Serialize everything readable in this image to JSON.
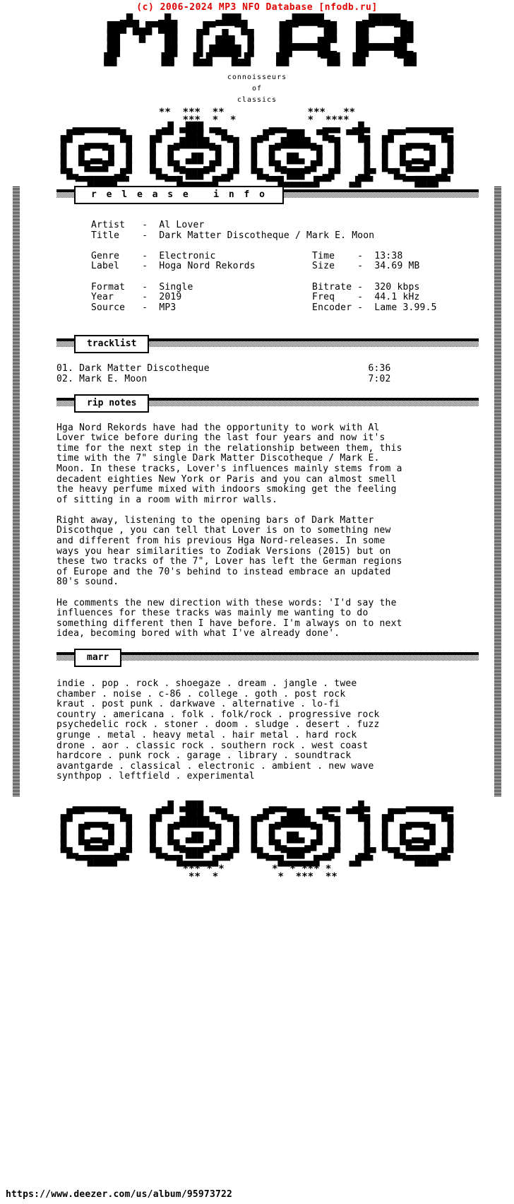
{
  "header": {
    "copyright": "(c) 2006-2024 MP3 NFO Database [nfodb.ru]",
    "copyright_color": "#e00000"
  },
  "logo": {
    "name": "MARR",
    "ascii": "  ▄█▄   ▄█▄      ▄███▄      ▄█████▄     ▄█████▄\n ███▀█▄█▀███    █▀   ▀█     ██▀   ▀██   ██▀   ▀██\n ██  ▀█▀  ██   █▀ ▄█▄ ▀█    ██     ██   ██     ██\n ██   ▀   ██   █  ███  █    ██▄▄▄▄██▀   ██▄▄▄▄██▀\n ██       ██   █ █████ █    ██▀▀▀▀██▄   ██▀▀▀▀██▄\n ██       ██   █▄█   █▄█    ██     ▀██  ██     ▀██\n ▀▀       ▀▀   ▀▀▀   ▀▀▀    ▀▀      ▀▀  ▀▀      ▀▀",
    "tagline_1": "connoisseurs",
    "tagline_2": "of",
    "tagline_3": "classics",
    "ornament_top": "  ▄▄▄▄▄▄▄▄       ▄█ ▄███ ▄▄        ▄▄▄      ▄▄▄  ▄█▄      ▄▄▄▄▄▄▄▄\n▄█▀▀    ▀▀█▄   ▄█▀▀  ███  ▀█▄    ▄█▀  ███  ▀█▄  ▀▀█▄  ▄█▀▀    ▀▀█▄\n█▀  ▄▄▄▄  ▀█   █▀  ▄█████▄  ▀█  █▀  ▄█████▄  ▀█   ▀█  █▀  ▄▄▄▄  ▀█\n█  █▀  ▀█  █   █  █▀     ▀█  █  █  █▀     ▀█  █    █  █  █▀  ▀█  █\n█  █ ▄▄ █  █   █  █  ▄██  █  █  █  █  ██▄  █  █    █  █  █ ▄▄ █  █\n█  ▀█▄▄█▀  █   █  ▀█▄   ▄█▀  █  █  ▀█▄   ▄█▀  █    █  █  ▀█▄▄█▀  █\n▀█▄      ▄█▀   ▀█▄  ▀███▀  ▄█▀  ▀█▄  ▀███▀  ▄█▀   ▄█▀  ▀█▄     ▄█▀\n  ▀▀█████▀▀      ▀▀█▄▄▄▄▄█▀▀      ▀▀█▄▄▄▄▄█▀▀   ▄█▀▀     ▀▀████▀▀",
    "ornament_bottom": "  ▄▄▄▄▄▄▄▄       ▄█ ▄███ ▄▄        ▄▄▄      ▄▄▄  ▄█▄      ▄▄▄▄▄▄▄▄\n▄█▀▀    ▀▀█▄   ▄█▀▀  ███  ▀█▄    ▄█▀  ███  ▀█▄  ▀▀█▄  ▄█▀▀    ▀▀█▄\n█▀  ▄▄▄▄  ▀█   █▀  ▄█████▄  ▀█  █▀  ▄█████▄  ▀█   ▀█  █▀  ▄▄▄▄  ▀█\n█  █▀  ▀█  █   █  █▀     ▀█  █  █  █▀     ▀█  █    █  █  █▀  ▀█  █\n█  █ ▄▄ █  █   █  █  ▄██  █  █  █  █  ██▄  █  █    █  █  █ ▄▄ █  █\n█  ▀█▄▄█▀  █   █  ▀█▄   ▄█▀  █  █  ▀█▄   ▄█▀  █    █  █  ▀█▄▄█▀  █\n▀█▄      ▄█▀   ▀█▄  ▀███▀  ▄█▀  ▀█▄  ▀███▀  ▄█▀   ▄█▀  ▀█▄     ▄█▀\n  ▀▀█████▀▀      ▀▀█▄▄▄▄▄█▀▀      ▀▀█▄▄▄▄▄█▀▀   ▄█▀▀     ▀▀████▀▀",
    "stars_top": "**  ***  **              ***   **\n   ***  *  *            *  ****",
    "stars_bottom": "*** * *        *  * *** *\n  **  *          *  ***  **"
  },
  "sections": {
    "release_info_label": "r e l e a s e   i n f o",
    "tracklist_label": "tracklist",
    "rip_notes_label": "rip notes",
    "marr_label": "marr"
  },
  "release_info": {
    "left": [
      {
        "key": "Artist",
        "sep": "-",
        "value": "Al Lover"
      },
      {
        "key": "Title",
        "sep": "-",
        "value": "Dark Matter Discotheque / Mark E. Moon"
      },
      {
        "key": "Genre",
        "sep": "-",
        "value": "Electronic"
      },
      {
        "key": "Label",
        "sep": "-",
        "value": "Hoga Nord Rekords"
      },
      {
        "key": "Format",
        "sep": "-",
        "value": "Single"
      },
      {
        "key": "Year",
        "sep": "-",
        "value": "2019"
      },
      {
        "key": "Source",
        "sep": "-",
        "value": "MP3"
      }
    ],
    "right": [
      {
        "key": "Time",
        "sep": "-",
        "value": "13:38"
      },
      {
        "key": "Size",
        "sep": "-",
        "value": "34.69 MB"
      },
      {
        "key": "Bitrate",
        "sep": "-",
        "value": "320 kbps"
      },
      {
        "key": "Freq",
        "sep": "-",
        "value": "44.1 kHz"
      },
      {
        "key": "Encoder",
        "sep": "-",
        "value": "Lame 3.99.5"
      }
    ],
    "block": "Artist   -  Al Lover\nTitle    -  Dark Matter Discotheque / Mark E. Moon\n\nGenre    -  Electronic                 Time    -  13:38\nLabel    -  Hoga Nord Rekords          Size    -  34.69 MB\n\nFormat   -  Single                     Bitrate -  320 kbps\nYear     -  2019                       Freq    -  44.1 kHz\nSource   -  MP3                        Encoder -  Lame 3.99.5"
  },
  "tracklist": {
    "tracks": [
      {
        "num": "01.",
        "title": "Dark Matter Discotheque",
        "time": "6:36"
      },
      {
        "num": "02.",
        "title": "Mark E. Moon",
        "time": "7:02"
      }
    ],
    "block": "01. Dark Matter Discotheque                            6:36\n02. Mark E. Moon                                       7:02"
  },
  "rip_notes": {
    "paragraphs": [
      "Hga Nord Rekords have had the opportunity to work with Al\nLover twice before during the last four years and now it's\ntime for the next step in the relationship between them, this\ntime with the 7\" single Dark Matter Discotheque / Mark E.\nMoon. In these tracks, Lover's influences mainly stems from a\ndecadent eighties New York or Paris and you can almost smell\nthe heavy perfume mixed with indoors smoking get the feeling\nof sitting in a room with mirror walls.",
      "Right away, listening to the opening bars of Dark Matter\nDiscothque , you can tell that Lover is on to something new\nand different from his previous Hga Nord-releases. In some\nways you hear similarities to Zodiak Versions (2015) but on\nthese two tracks of the 7\", Lover has left the German regions\nof Europe and the 70's behind to instead embrace an updated\n80's sound.",
      "He comments the new direction with these words: 'I'd say the\ninfluences for these tracks was mainly me wanting to do\nsomething different then I have before. I'm always on to next\nidea, becoming bored with what I've already done'."
    ],
    "block": "Hga Nord Rekords have had the opportunity to work with Al\nLover twice before during the last four years and now it's\ntime for the next step in the relationship between them, this\ntime with the 7\" single Dark Matter Discotheque / Mark E.\nMoon. In these tracks, Lover's influences mainly stems from a\ndecadent eighties New York or Paris and you can almost smell\nthe heavy perfume mixed with indoors smoking get the feeling\nof sitting in a room with mirror walls.\n\nRight away, listening to the opening bars of Dark Matter\nDiscothque , you can tell that Lover is on to something new\nand different from his previous Hga Nord-releases. In some\nways you hear similarities to Zodiak Versions (2015) but on\nthese two tracks of the 7\", Lover has left the German regions\nof Europe and the 70's behind to instead embrace an updated\n80's sound.\n\nHe comments the new direction with these words: 'I'd say the\ninfluences for these tracks was mainly me wanting to do\nsomething different then I have before. I'm always on to next\nidea, becoming bored with what I've already done'."
  },
  "tags": {
    "lines": [
      "indie . pop . rock . shoegaze . dream . jangle . twee",
      "chamber . noise . c-86 . college . goth . post rock",
      "kraut . post punk . darkwave . alternative . lo-fi",
      "country . americana . folk . folk/rock . progressive rock",
      "psychedelic rock . stoner . doom . sludge . desert . fuzz",
      "grunge . metal . heavy metal . hair metal . hard rock",
      "drone . aor . classic rock . southern rock . west coast",
      "hardcore . punk rock . garage . library . soundtrack",
      "avantgarde . classical . electronic . ambient . new wave",
      "synthpop . leftfield . experimental"
    ],
    "block": "indie . pop . rock . shoegaze . dream . jangle . twee\nchamber . noise . c-86 . college . goth . post rock\nkraut . post punk . darkwave . alternative . lo-fi\ncountry . americana . folk . folk/rock . progressive rock\npsychedelic rock . stoner . doom . sludge . desert . fuzz\ngrunge . metal . heavy metal . hair metal . hard rock\ndrone . aor . classic rock . southern rock . west coast\nhardcore . punk rock . garage . library . soundtrack\navantgarde . classical . electronic . ambient . new wave\nsynthpop . leftfield . experimental"
  },
  "footer": {
    "url": "https://www.deezer.com/us/album/95973722"
  }
}
